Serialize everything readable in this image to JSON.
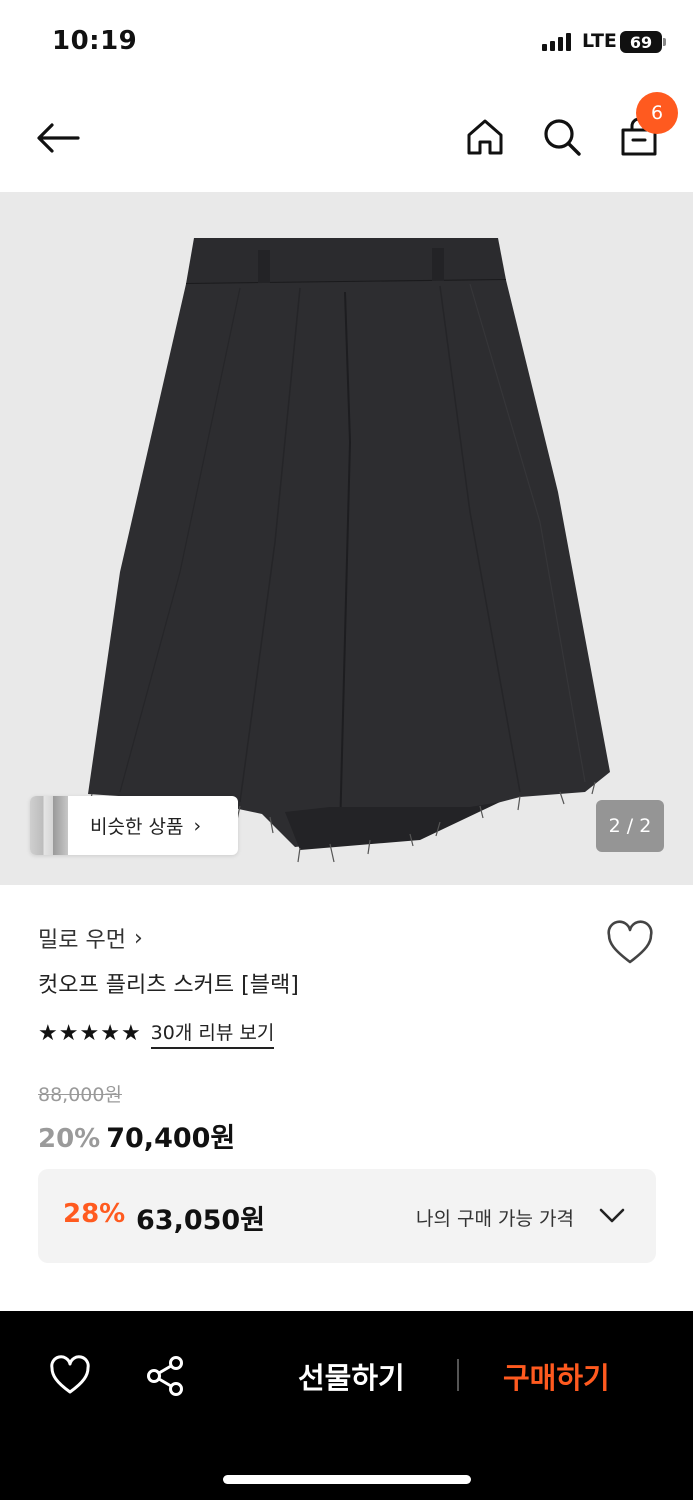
{
  "status_bar": {
    "time": "10:19",
    "network": "LTE",
    "battery": "69",
    "icons": [
      "signal-icon",
      "battery-icon"
    ]
  },
  "header": {
    "icons": [
      "back-arrow-icon",
      "home-icon",
      "search-icon",
      "shopping-bag-icon"
    ],
    "cart_count": "6"
  },
  "gallery": {
    "similar_label": "비슷한 상품",
    "similar_chevron": "›",
    "page_indicator": "2 / 2"
  },
  "product": {
    "brand": "밀로 우먼",
    "brand_chevron": "›",
    "title": "컷오프 플리츠 스커트 [블랙]",
    "rating_stars": 5,
    "review_link": "30개 리뷰 보기",
    "original_price": "88,000원",
    "sale_percent": "20%",
    "sale_price": "70,400원"
  },
  "my_price": {
    "percent": "28%",
    "price": "63,050원",
    "label": "나의 구매 가능 가격"
  },
  "bottom_bar": {
    "gift_label": "선물하기",
    "buy_label": "구매하기",
    "icons": [
      "heart-icon",
      "share-icon"
    ]
  },
  "colors": {
    "accent": "#ff5a1f",
    "muted": "#9a9a9a",
    "image_bg": "#e9e9e9",
    "bottom_bar_bg": "#000000"
  }
}
